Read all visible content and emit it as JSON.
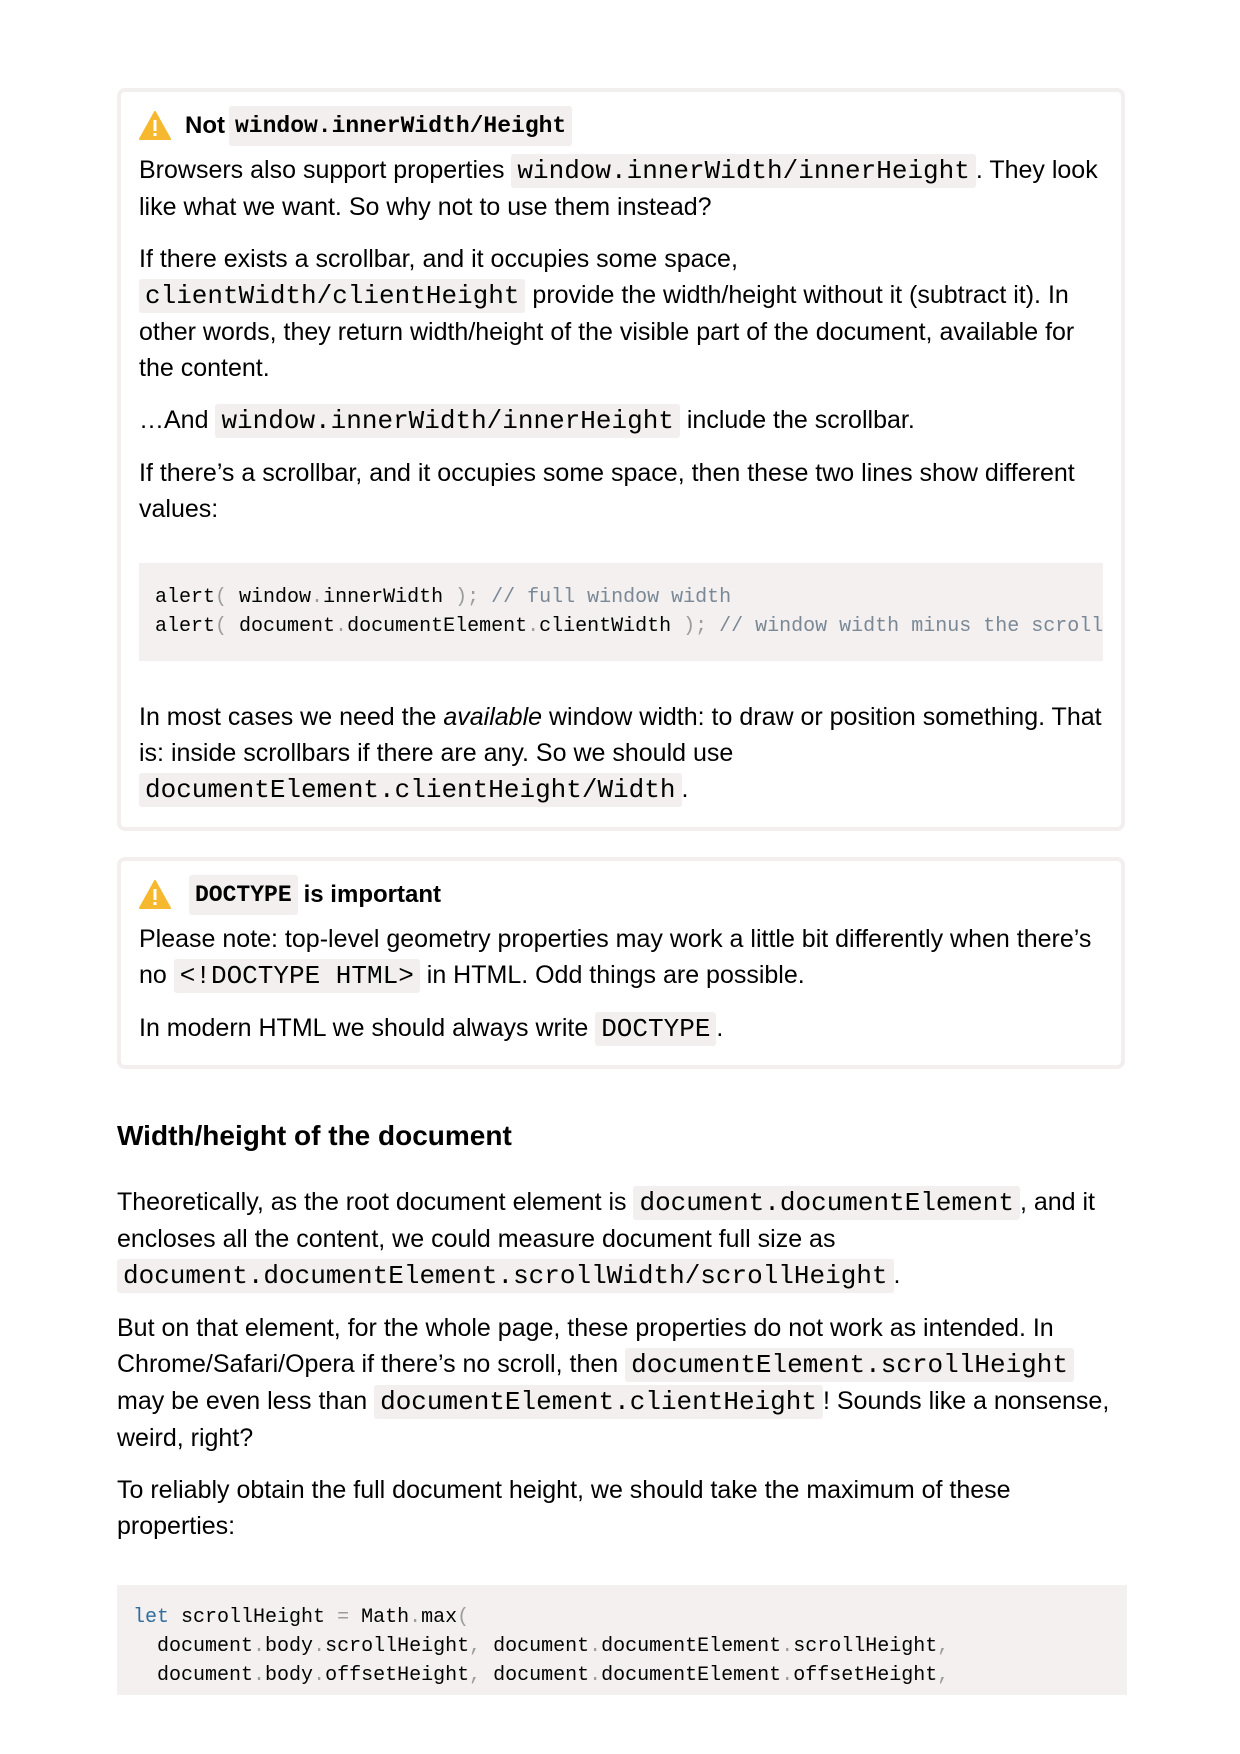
{
  "note1": {
    "title_pre": "Not",
    "title_code": "window.innerWidth/Height",
    "p1_a": "Browsers also support properties ",
    "p1_code": "window.innerWidth/innerHeight",
    "p1_b": ". They look like what we want. So why not to use them instead?",
    "p2_a": "If there exists a scrollbar, and it occupies some space, ",
    "p2_code": "clientWidth/clientHeight",
    "p2_b": " provide the width/height without it (subtract it). In other words, they return width/height of the visible part of the document, available for the content.",
    "p3_a": "…And ",
    "p3_code": "window.innerWidth/innerHeight",
    "p3_b": " include the scrollbar.",
    "p4": "If there’s a scrollbar, and it occupies some space, then these two lines show different values:",
    "code_line1_a": "alert",
    "code_line1_b": "window",
    "code_line1_c": "innerWidth",
    "code_line1_comment": "// full window width",
    "code_line2_a": "alert",
    "code_line2_b": "document",
    "code_line2_c": "documentElement",
    "code_line2_d": "clientWidth",
    "code_line2_comment": "// window width minus the scrollba",
    "p5_a": "In most cases we need the ",
    "p5_em": "available",
    "p5_b": " window width: to draw or position something. That is: inside scrollbars if there are any. So we should use ",
    "p5_code": "documentElement.clientHeight/Width",
    "p5_c": "."
  },
  "note2": {
    "title_code": "DOCTYPE",
    "title_post": "is important",
    "p1_a": "Please note: top-level geometry properties may work a little bit differently when there’s no ",
    "p1_code": "<!DOCTYPE HTML>",
    "p1_b": " in HTML. Odd things are possible.",
    "p2_a": "In modern HTML we should always write ",
    "p2_code": "DOCTYPE",
    "p2_b": "."
  },
  "section": {
    "heading": "Width/height of the document",
    "p1_a": "Theoretically, as the root document element is ",
    "p1_code1": "document.documentElement",
    "p1_b": ", and it encloses all the content, we could measure document full size as ",
    "p1_code2": "document.documentElement.scrollWidth/scrollHeight",
    "p1_c": ".",
    "p2_a": "But on that element, for the whole page, these properties do not work as intended. In Chrome/Safari/Opera if there’s no scroll, then ",
    "p2_code1": "documentElement.scrollHeight",
    "p2_b": " may be even less than ",
    "p2_code2": "documentElement.clientHeight",
    "p2_c": "! Sounds like a nonsense, weird, right?",
    "p3": "To reliably obtain the full document height, we should take the maximum of these properties:",
    "code_kw": "let",
    "code_var": "scrollHeight",
    "code_math": "Math",
    "code_max": "max",
    "code_doc": "document",
    "code_body": "body",
    "code_scrollHeight": "scrollHeight",
    "code_docEl": "documentElement",
    "code_offsetHeight": "offsetHeight"
  }
}
